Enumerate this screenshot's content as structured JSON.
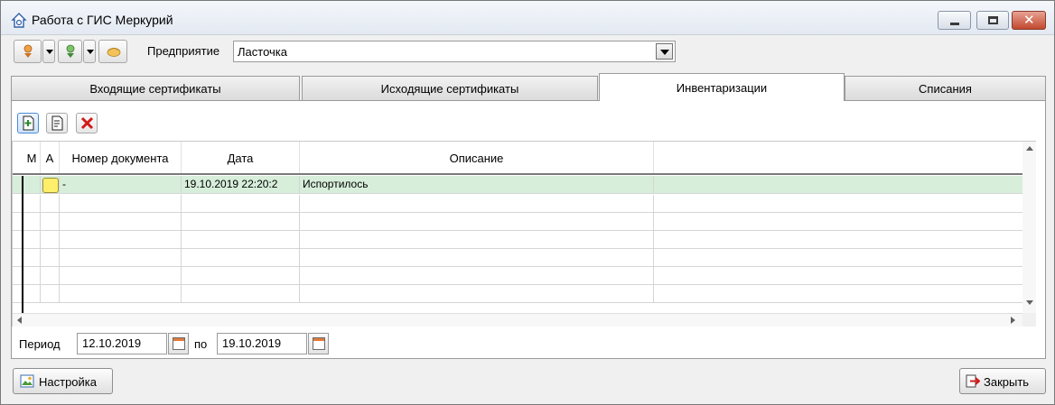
{
  "window": {
    "title": "Работа с ГИС Меркурий",
    "accent": "#e3e9f2"
  },
  "toolbar": {
    "enterprise_label": "Предприятие",
    "enterprise_value": "Ласточка"
  },
  "tabs": [
    {
      "label": "Входящие сертификаты"
    },
    {
      "label": "Исходящие сертификаты"
    },
    {
      "label": "Инвентаризации"
    },
    {
      "label": "Списания"
    }
  ],
  "active_tab": "Инвентаризации",
  "grid": {
    "columns": [
      "М",
      "А",
      "Номер документа",
      "Дата",
      "Описание"
    ],
    "rows": [
      {
        "number": "-",
        "date": "19.10.2019 22:20:2",
        "description": "Испортилось"
      }
    ],
    "selected_row_color": "#d7eeda"
  },
  "period": {
    "label": "Период",
    "from": "12.10.2019",
    "to_label": "по",
    "to": "19.10.2019"
  },
  "buttons": {
    "settings": "Настройка",
    "close": "Закрыть"
  }
}
